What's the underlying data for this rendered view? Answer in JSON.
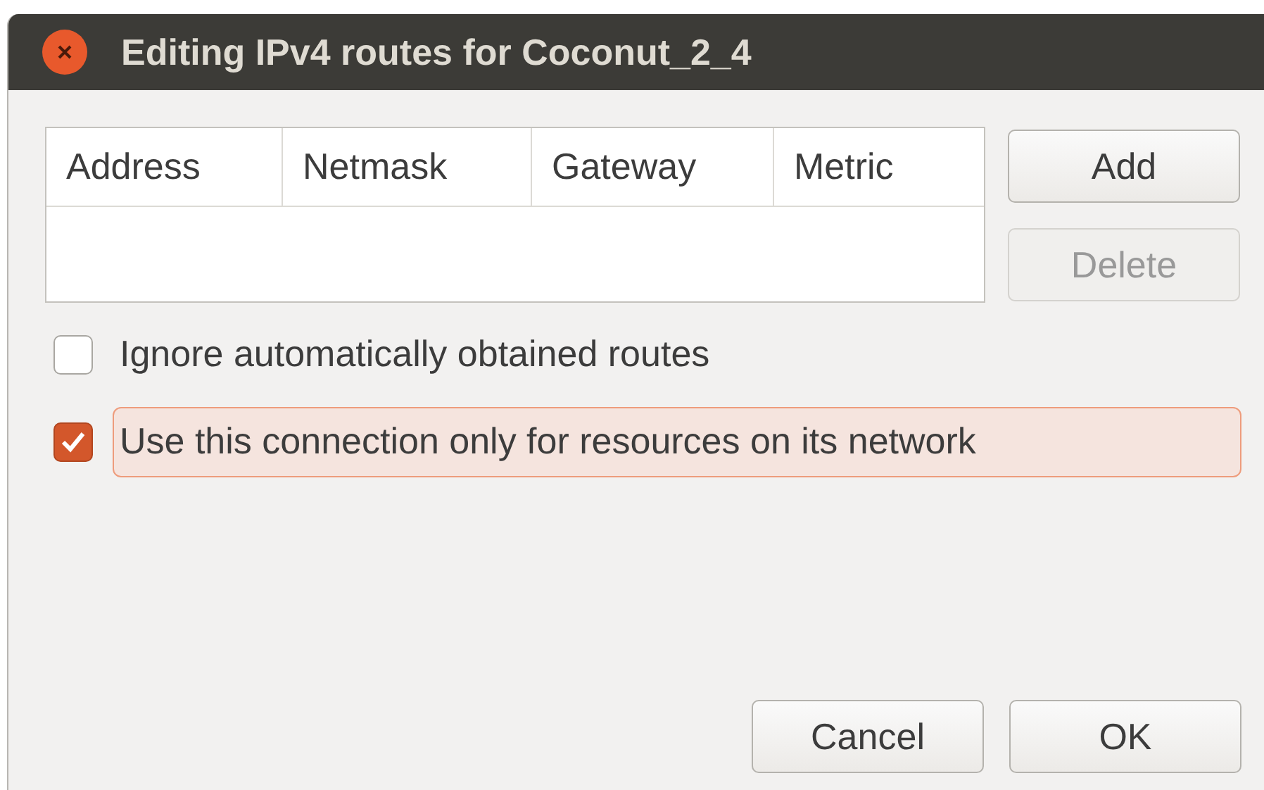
{
  "window": {
    "title": "Editing IPv4 routes for Coconut_2_4"
  },
  "table": {
    "columns": [
      "Address",
      "Netmask",
      "Gateway",
      "Metric"
    ]
  },
  "side_buttons": [
    {
      "label": "Add",
      "disabled": false
    },
    {
      "label": "Delete",
      "disabled": true
    }
  ],
  "options": [
    {
      "label": "Ignore automatically obtained routes",
      "checked": false,
      "focused": false
    },
    {
      "label": "Use this connection only for resources on its network",
      "checked": true,
      "focused": true
    }
  ],
  "buttons": [
    {
      "label": "Cancel",
      "disabled": false
    },
    {
      "label": "OK",
      "disabled": false
    }
  ]
}
